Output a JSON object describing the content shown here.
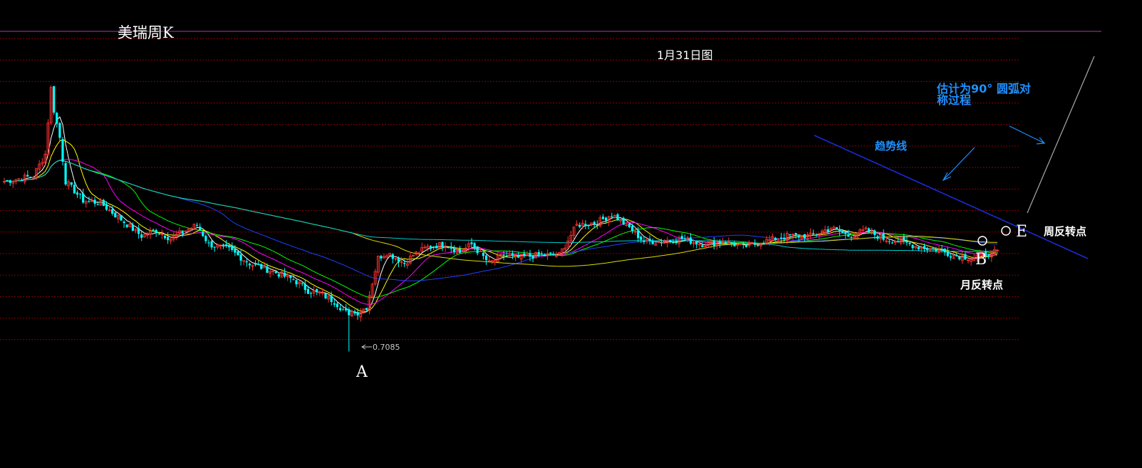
{
  "title": "美瑞周K",
  "date_label": "1月31日图",
  "annotations": {
    "estimate_line1": "估计为90° 圆弧对",
    "estimate_line2": "称过程",
    "trend_line": "趋势线",
    "point_a": "A",
    "point_b": "B",
    "point_e": "E",
    "month_reversal": "月反转点",
    "week_reversal": "周反转点",
    "low_value": "0.7085"
  },
  "colors": {
    "background": "#000000",
    "up_candle": "#ff3030",
    "down_candle": "#00ffff",
    "grid": "#8b0000",
    "trend_line": "#1a2bd6",
    "annotation_blue": "#1e90ff",
    "ma": [
      "#ffffff",
      "#ffff00",
      "#ff00ff",
      "#00ff00",
      "#1e40ff",
      "#dcdc00",
      "#00cccc"
    ]
  },
  "chart_data": {
    "type": "candlestick",
    "title": "美瑞周K",
    "x": "weeks",
    "ylim": [
      0.7,
      1.3
    ],
    "grid": true,
    "low_marker": 0.7085,
    "close_path": [
      [
        0,
        1.02
      ],
      [
        10,
        1.03
      ],
      [
        14,
        1.07
      ],
      [
        16,
        1.19
      ],
      [
        17,
        1.15
      ],
      [
        19,
        1.1
      ],
      [
        21,
        1.02
      ],
      [
        27,
        0.985
      ],
      [
        33,
        0.98
      ],
      [
        40,
        0.95
      ],
      [
        47,
        0.92
      ],
      [
        52,
        0.93
      ],
      [
        57,
        0.915
      ],
      [
        62,
        0.93
      ],
      [
        66,
        0.94
      ],
      [
        70,
        0.905
      ],
      [
        77,
        0.895
      ],
      [
        84,
        0.87
      ],
      [
        92,
        0.855
      ],
      [
        99,
        0.84
      ],
      [
        104,
        0.82
      ],
      [
        108,
        0.815
      ],
      [
        113,
        0.8
      ],
      [
        118,
        0.775
      ],
      [
        121,
        0.78
      ],
      [
        124,
        0.79
      ],
      [
        128,
        0.88
      ],
      [
        131,
        0.89
      ],
      [
        137,
        0.87
      ],
      [
        140,
        0.885
      ],
      [
        145,
        0.9
      ],
      [
        151,
        0.905
      ],
      [
        156,
        0.89
      ],
      [
        160,
        0.905
      ],
      [
        166,
        0.87
      ],
      [
        171,
        0.885
      ],
      [
        176,
        0.88
      ],
      [
        183,
        0.885
      ],
      [
        190,
        0.885
      ],
      [
        196,
        0.94
      ],
      [
        203,
        0.945
      ],
      [
        208,
        0.96
      ],
      [
        214,
        0.935
      ],
      [
        219,
        0.91
      ],
      [
        225,
        0.91
      ],
      [
        232,
        0.915
      ],
      [
        239,
        0.905
      ],
      [
        246,
        0.91
      ],
      [
        253,
        0.9
      ],
      [
        260,
        0.91
      ],
      [
        268,
        0.92
      ],
      [
        276,
        0.92
      ],
      [
        283,
        0.935
      ],
      [
        289,
        0.92
      ],
      [
        295,
        0.93
      ],
      [
        301,
        0.915
      ],
      [
        307,
        0.91
      ],
      [
        313,
        0.9
      ],
      [
        319,
        0.895
      ],
      [
        325,
        0.885
      ],
      [
        331,
        0.88
      ],
      [
        337,
        0.888
      ],
      [
        340,
        0.89
      ]
    ],
    "moving_averages": [
      5,
      10,
      20,
      30,
      60,
      120,
      250
    ]
  }
}
